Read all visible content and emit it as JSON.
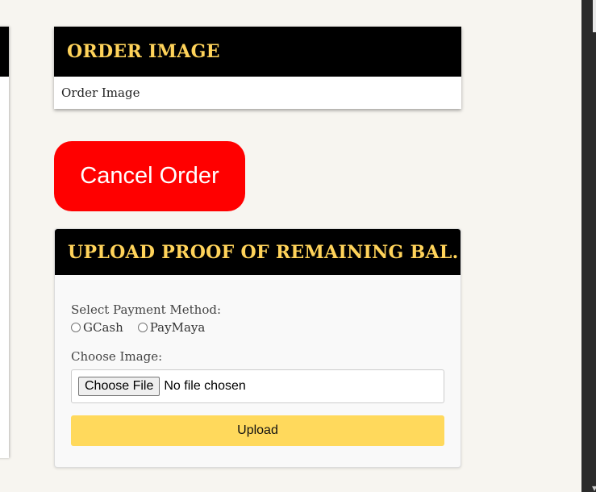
{
  "order_card": {
    "title": "ORDER IMAGE",
    "image_alt": "Order Image"
  },
  "cancel_button": {
    "label": "Cancel Order",
    "color": "#ff0000"
  },
  "upload_card": {
    "title": "UPLOAD PROOF OF REMAINING BAL.",
    "payment_label": "Select Payment Method:",
    "payment_options": [
      "GCash",
      "PayMaya"
    ],
    "choose_image_label": "Choose Image:",
    "file_button_label": "Choose File",
    "file_status": "No file chosen",
    "upload_button_label": "Upload"
  },
  "colors": {
    "header_bg": "#000000",
    "header_text": "#ffd35a",
    "upload_button": "#ffd95c",
    "page_bg": "#f7f5f0"
  }
}
